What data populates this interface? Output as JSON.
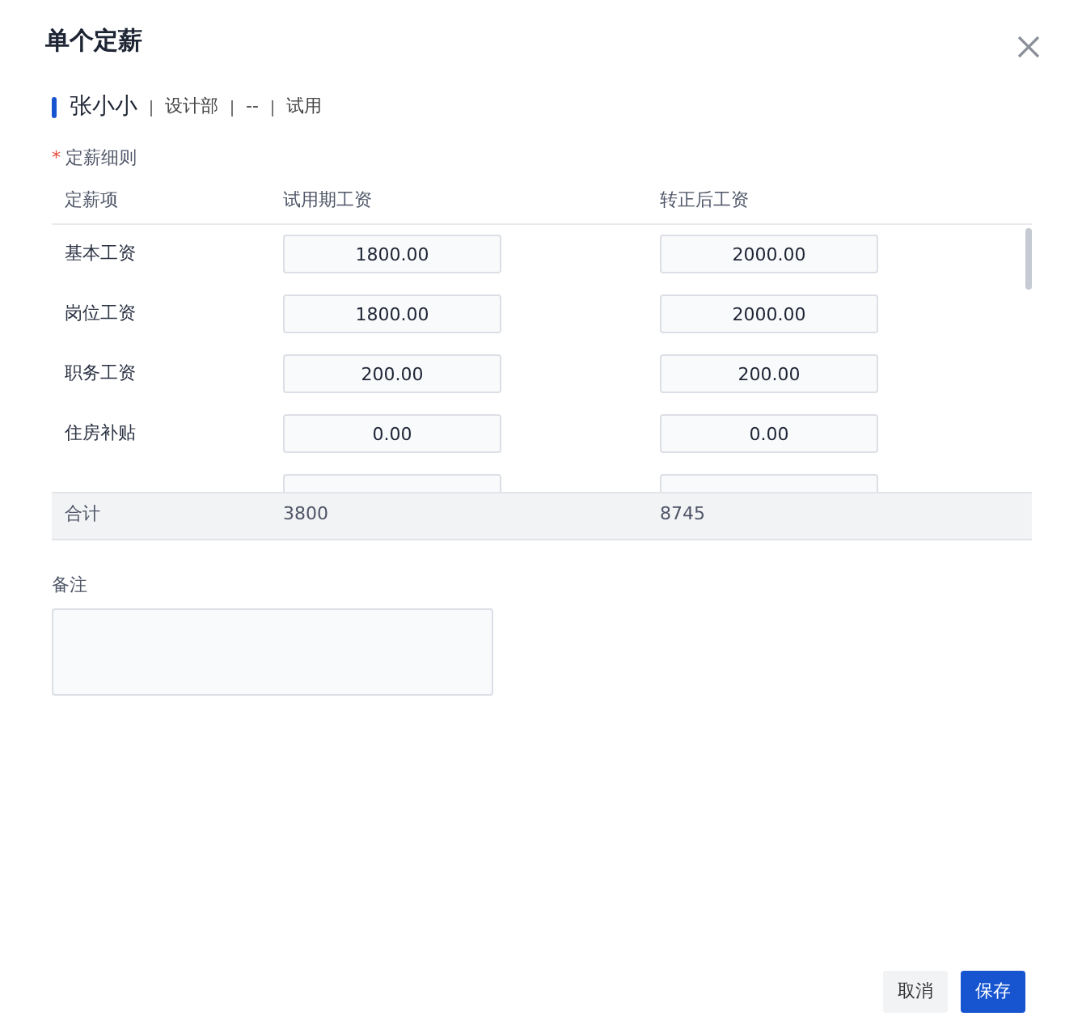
{
  "dialog": {
    "title": "单个定薪"
  },
  "employee": {
    "name": "张小小",
    "fields": [
      "设计部",
      "--",
      "试用"
    ]
  },
  "section": {
    "mark": "*",
    "label": "定薪细则"
  },
  "table": {
    "columns": [
      "定薪项",
      "试用期工资",
      "转正后工资"
    ],
    "rows": [
      {
        "kind": "full",
        "item": "基本工资",
        "probation": "1800.00",
        "regular": "2000.00"
      },
      {
        "kind": "full",
        "item": "岗位工资",
        "probation": "1800.00",
        "regular": "2000.00"
      },
      {
        "kind": "full",
        "item": "职务工资",
        "probation": "200.00",
        "regular": "200.00"
      },
      {
        "kind": "full",
        "item": "住房补贴",
        "probation": "0.00",
        "regular": "0.00"
      },
      {
        "kind": "cut"
      }
    ],
    "total": {
      "label": "合计",
      "probation": "3800",
      "regular": "8745"
    }
  },
  "remark": {
    "label": "备注"
  },
  "buttons": [
    {
      "label": "取消",
      "kind": "secondary"
    },
    {
      "label": "保存",
      "kind": "primary"
    }
  ]
}
